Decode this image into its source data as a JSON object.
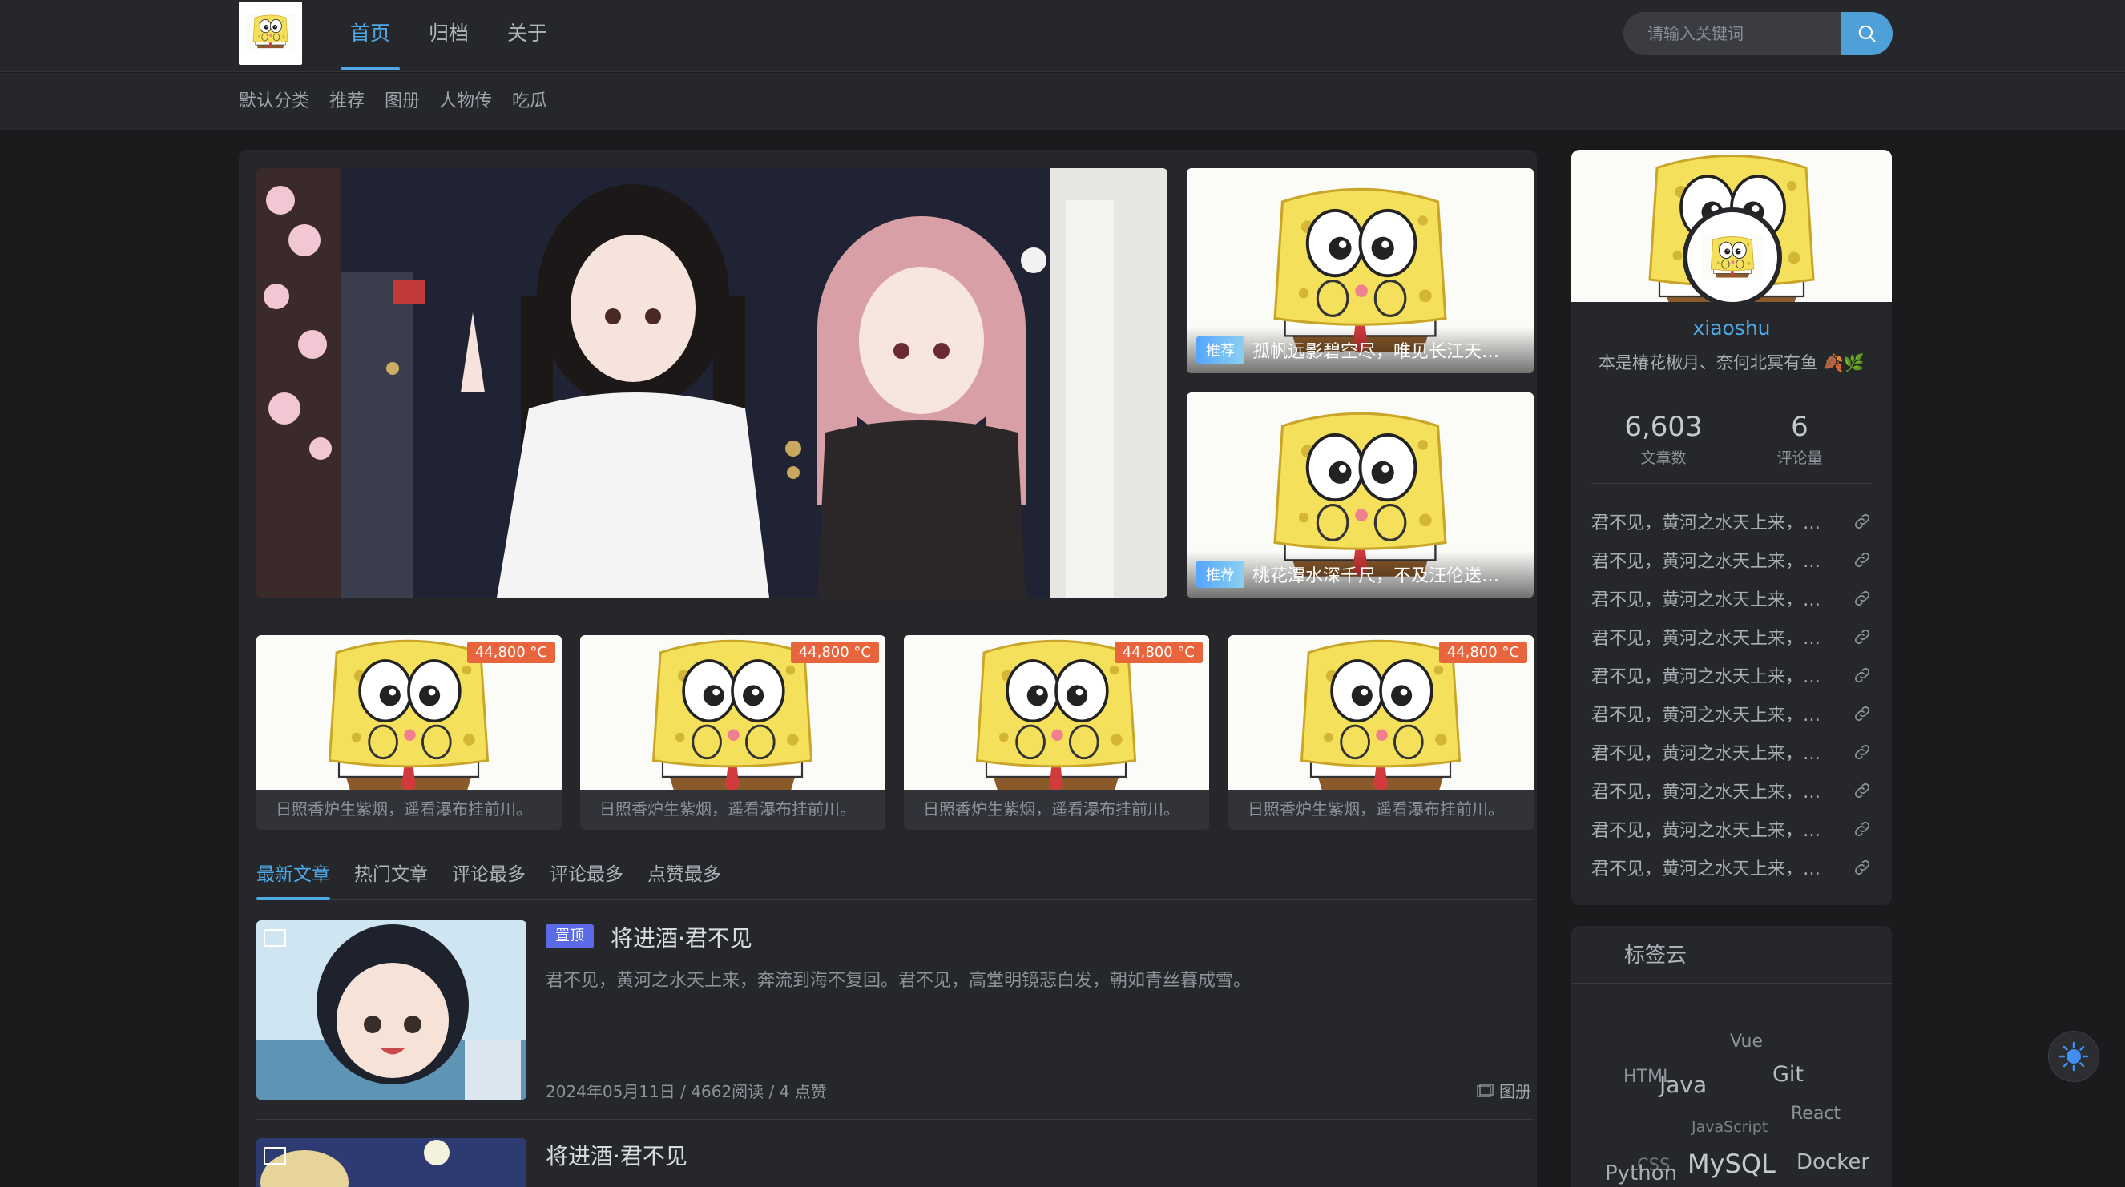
{
  "header": {
    "nav": [
      "首页",
      "归档",
      "关于"
    ],
    "search_placeholder": "请输入关键词",
    "categories": [
      "默认分类",
      "推荐",
      "图册",
      "人物传",
      "吃瓜"
    ]
  },
  "featured": {
    "side_cards": [
      {
        "badge": "推荐",
        "title": "孤帆远影碧空尽，唯见长江天际流。"
      },
      {
        "badge": "推荐",
        "title": "桃花潭水深千尺，不及汪伦送我情。"
      }
    ],
    "grid_cards": [
      {
        "temp": "44,800 °C",
        "caption": "日照香炉生紫烟，遥看瀑布挂前川。"
      },
      {
        "temp": "44,800 °C",
        "caption": "日照香炉生紫烟，遥看瀑布挂前川。"
      },
      {
        "temp": "44,800 °C",
        "caption": "日照香炉生紫烟，遥看瀑布挂前川。"
      },
      {
        "temp": "44,800 °C",
        "caption": "日照香炉生紫烟，遥看瀑布挂前川。"
      }
    ]
  },
  "tabs": [
    "最新文章",
    "热门文章",
    "评论最多",
    "评论最多",
    "点赞最多"
  ],
  "articles": [
    {
      "pin": "置顶",
      "title": "将进酒·君不见",
      "excerpt": "君不见，黄河之水天上来，奔流到海不复回。君不见，高堂明镜悲白发，朝如青丝暮成雪。",
      "date": "2024年05月11日",
      "reads": "4662阅读",
      "likes": "4 点赞",
      "category": "图册"
    },
    {
      "title": "将进酒·君不见"
    }
  ],
  "profile": {
    "name": "xiaoshu",
    "bio": "本是椿花楸月、奈何北冥有鱼 🍂🌿",
    "posts": "6,603",
    "posts_label": "文章数",
    "comments": "6",
    "comments_label": "评论量",
    "links": [
      "君不见，黄河之水天上来，奔流到海不复回",
      "君不见，黄河之水天上来，奔流到海不复回",
      "君不见，黄河之水天上来，奔流到海不复回",
      "君不见，黄河之水天上来，奔流到海不复回",
      "君不见，黄河之水天上来，奔流到海不复回",
      "君不见，黄河之水天上来，奔流到海不复回",
      "君不见，黄河之水天上来，奔流到海不复回",
      "君不见，黄河之水天上来，奔流到海不复回",
      "君不见，黄河之水天上来，奔流到海不复回",
      "君不见，黄河之水天上来，奔流到海不复回"
    ]
  },
  "tag_cloud": {
    "title": "标签云",
    "tags": [
      "Vue",
      "HTML",
      "Java",
      "Git",
      "React",
      "JavaScript",
      "CSS",
      "Python",
      "MySQL",
      "Docker"
    ]
  },
  "colors": {
    "accent": "#4fa9e6",
    "hot": "#e8643c",
    "pin": "#5b6ae6"
  }
}
